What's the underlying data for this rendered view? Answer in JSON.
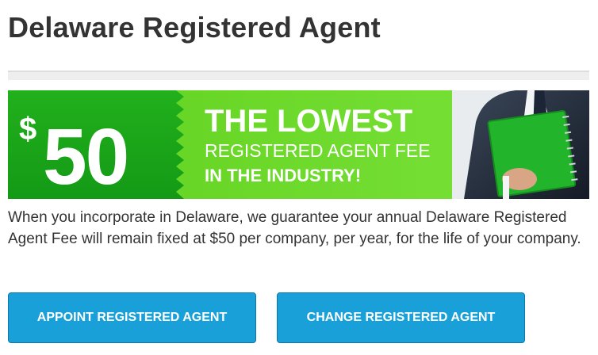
{
  "page": {
    "title": "Delaware Registered Agent"
  },
  "banner": {
    "dollar_sign": "$",
    "price": "50",
    "headline": "THE LOWEST",
    "subline": "REGISTERED AGENT FEE",
    "tagline": "IN THE INDUSTRY!",
    "colors": {
      "dark_green": "#1aa81a",
      "light_green": "#6ede2a",
      "text": "#ffffff"
    },
    "image": "businessman-holding-green-folder"
  },
  "intro": {
    "text": "When you incorporate in Delaware, we guarantee your annual Delaware Registered Agent Fee will remain fixed at $50 per company, per year, for the life of your company."
  },
  "buttons": {
    "appoint_label": "APPOINT REGISTERED AGENT",
    "change_label": "CHANGE REGISTERED AGENT",
    "color": "#1aa0d8"
  }
}
